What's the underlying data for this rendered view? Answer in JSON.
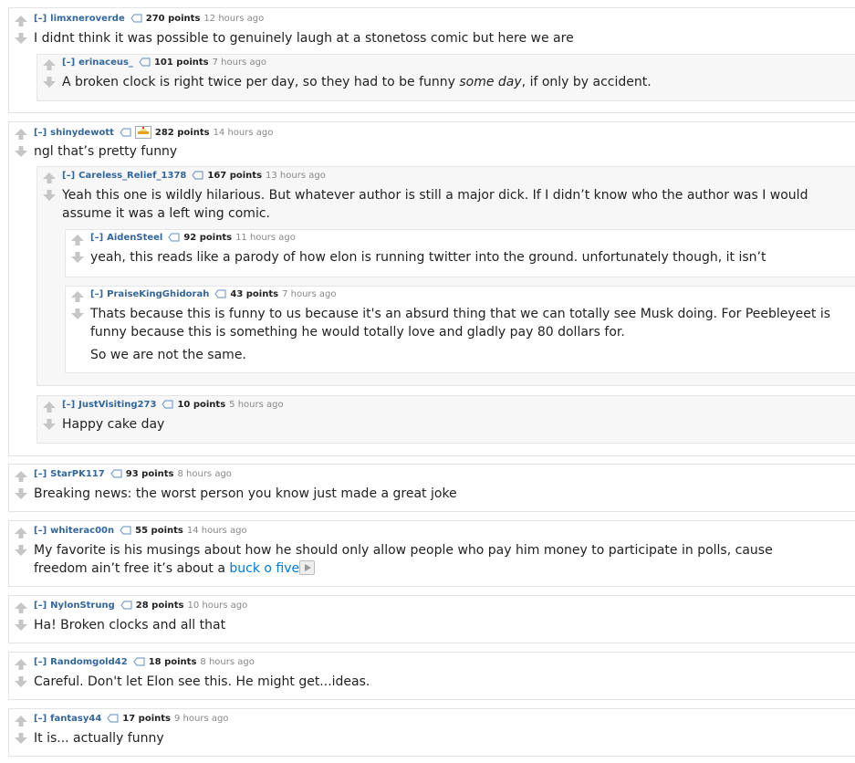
{
  "ui": {
    "expand_label": "[–]"
  },
  "comments": [
    {
      "author": "limxneroverde",
      "score": "270 points",
      "time": "12 hours ago",
      "body": "I didnt think it was possible to genuinely laugh at a stonetoss comic but here we are"
    },
    {
      "author": "erinaceus_",
      "score": "101 points",
      "time": "7 hours ago",
      "body_before": "A broken clock is right twice per day, so they had to be funny ",
      "body_em": "some day",
      "body_after": ", if only by accident."
    },
    {
      "author": "shinydewott",
      "score": "282 points",
      "time": "14 hours ago",
      "body": "ngl that’s pretty funny"
    },
    {
      "author": "Careless_Relief_1378",
      "score": "167 points",
      "time": "13 hours ago",
      "body": "Yeah this one is wildly hilarious. But whatever author is still a major dick. If I didn’t know who the author was I would assume it was a left wing comic."
    },
    {
      "author": "AidenSteel",
      "score": "92 points",
      "time": "11 hours ago",
      "body": "yeah, this reads like a parody of how elon is running twitter into the ground. unfortunately though, it isn’t"
    },
    {
      "author": "PraiseKingGhidorah",
      "score": "43 points",
      "time": "7 hours ago",
      "body_p1": "Thats because this is funny to us because it's an absurd thing that we can totally see Musk doing. For Peebleyeet is funny because this is something he would totally love and gladly pay 80 dollars for.",
      "body_p2": "So we are not the same."
    },
    {
      "author": "JustVisiting273",
      "score": "10 points",
      "time": "5 hours ago",
      "body": "Happy cake day"
    },
    {
      "author": "StarPK117",
      "score": "93 points",
      "time": "8 hours ago",
      "body": "Breaking news: the worst person you know just made a great joke"
    },
    {
      "author": "whiterac00n",
      "score": "55 points",
      "time": "14 hours ago",
      "body_before": "My favorite is his musings about how he should only allow people who pay him money to participate in polls, cause freedom ain’t free it’s about a ",
      "body_link": "buck o five"
    },
    {
      "author": "NylonStrung",
      "score": "28 points",
      "time": "10 hours ago",
      "body": "Ha! Broken clocks and all that"
    },
    {
      "author": "Randomgold42",
      "score": "18 points",
      "time": "8 hours ago",
      "body": "Careful. Don't let Elon see this. He might get...ideas."
    },
    {
      "author": "fantasy44",
      "score": "17 points",
      "time": "9 hours ago",
      "body": "It is... actually funny"
    }
  ],
  "colors": {
    "author": "#336699",
    "link": "#0079d3",
    "text": "#222222",
    "meta": "#888888",
    "arrow": "#c6c6c6"
  },
  "icons": [
    "up-arrow-icon",
    "down-arrow-icon",
    "tag-icon",
    "flair-icon",
    "play-icon"
  ]
}
